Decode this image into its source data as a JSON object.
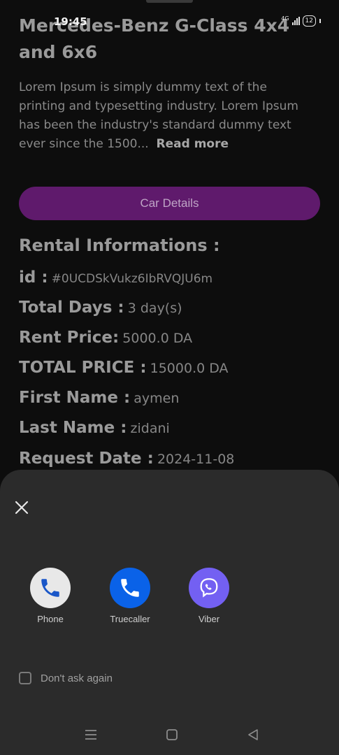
{
  "status_bar": {
    "time": "19:45",
    "network": "4G",
    "battery": "12"
  },
  "car": {
    "title": "Mercedes-Benz G-Class 4x4 and 6x6",
    "description": "Lorem Ipsum is simply dummy text of the printing and typesetting industry. Lorem Ipsum has been the industry's standard dummy text ever since the 1500...",
    "read_more": "Read more",
    "details_button": "Car Details"
  },
  "rental": {
    "section_title": "Rental Informations :",
    "rows": [
      {
        "label": "id :",
        "value": "#0UCDSkVukz6IbRVQJU6m"
      },
      {
        "label": "Total Days :",
        "value": "3 day(s)"
      },
      {
        "label": "Rent Price:",
        "value": "5000.0 DA"
      },
      {
        "label": "TOTAL PRICE :",
        "value": "15000.0 DA"
      },
      {
        "label": "First Name :",
        "value": "aymen"
      },
      {
        "label": "Last Name :",
        "value": "zidani"
      },
      {
        "label": "Request Date :",
        "value": "2024-11-08"
      }
    ]
  },
  "sheet": {
    "close_icon": "close-icon",
    "apps": [
      {
        "label": "Phone",
        "icon": "phone-app-icon",
        "color": "#e8e8e8"
      },
      {
        "label": "Truecaller",
        "icon": "truecaller-app-icon",
        "color": "#0a62e8"
      },
      {
        "label": "Viber",
        "icon": "viber-app-icon",
        "color": "#7360f2"
      }
    ],
    "dont_ask_label": "Don't ask again"
  },
  "colors": {
    "accent": "#5f1a6c",
    "sheet_bg": "#2b2b2b",
    "page_bg": "#0d0d0d"
  }
}
